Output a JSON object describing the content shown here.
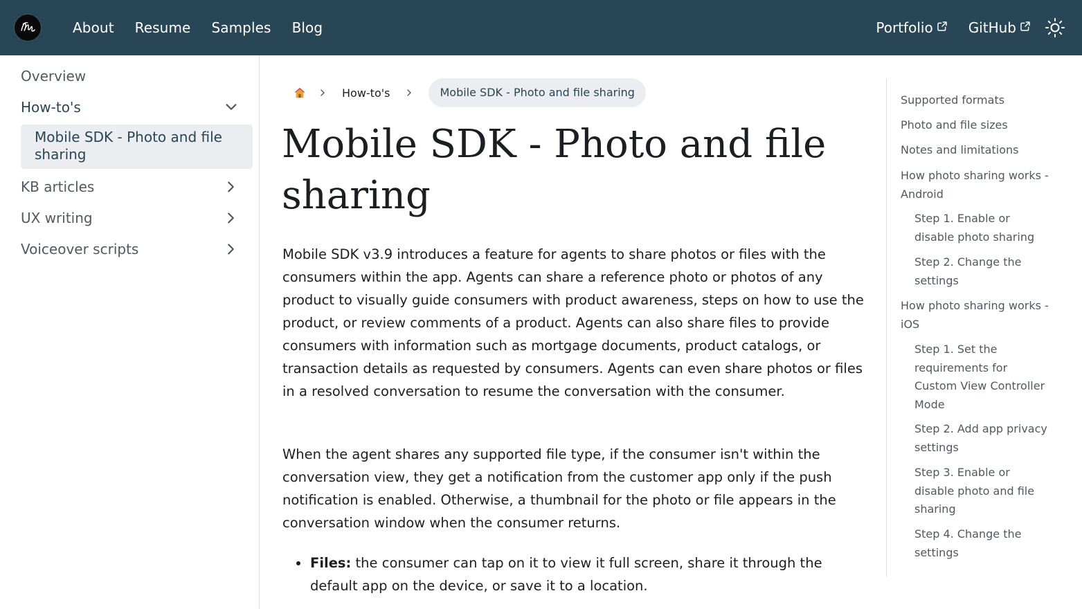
{
  "navbar": {
    "logo_alt": "RM",
    "links": [
      "About",
      "Resume",
      "Samples",
      "Blog"
    ],
    "external": [
      "Portfolio",
      "GitHub"
    ],
    "theme_icon": "sun-icon",
    "bg_color": "#284655"
  },
  "sidebar": {
    "overview": "Overview",
    "howtos": "How-to's",
    "active_item": "Mobile SDK - Photo and file sharing",
    "kb": "KB articles",
    "ux": "UX writing",
    "voiceover": "Voiceover scripts"
  },
  "breadcrumbs": {
    "home_icon": "home-icon",
    "parent": "How-to's",
    "current": "Mobile SDK - Photo and file sharing"
  },
  "article": {
    "title": "Mobile SDK - Photo and file sharing",
    "para1": "Mobile SDK v3.9 introduces a feature for agents to share photos or files with the consumers within the app. Agents can share a reference photo or photos of any product to visually guide consumers with product awareness, steps on how to use the product, or review comments of a product. Agents can also share files to provide consumers with information such as mortgage documents, product catalogs, or transaction details as requested by consumers. Agents can even share photos or files in a resolved conversation to resume the conversation with the consumer.",
    "para2": "When the agent shares any supported file type, if the consumer isn't within the conversation view, they get a notification from the customer app only if the push notification is enabled. Otherwise, a thumbnail for the photo or file appears in the conversation window when the consumer returns.",
    "bullet1_bold": "Files:",
    "bullet1_text": " the consumer can tap on it to view it full screen, share it through the default app on the device, or save it to a location."
  },
  "toc": [
    "Supported formats",
    "Photo and file sizes",
    "Notes and limitations",
    "How photo sharing works - Android",
    "Step 1. Enable or disable photo sharing",
    "Step 2. Change the settings",
    "How photo sharing works - iOS",
    "Step 1. Set the requirements for Custom View Controller Mode",
    "Step 2. Add app privacy settings",
    "Step 3. Enable or disable photo and file sharing",
    "Step 4. Change the settings"
  ]
}
